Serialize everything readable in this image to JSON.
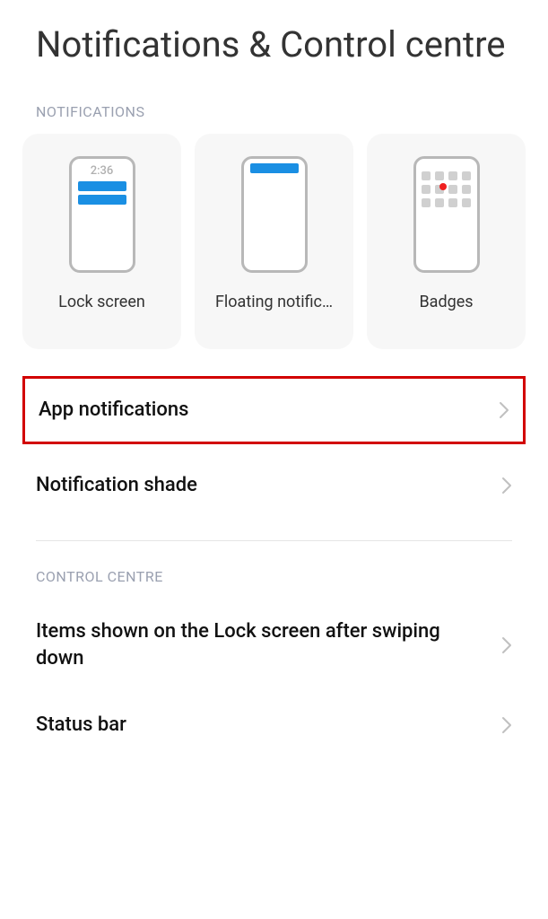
{
  "page": {
    "title": "Notifications & Control centre"
  },
  "section_notifications": {
    "header": "NOTIFICATIONS",
    "cards": {
      "lock_screen": {
        "label": "Lock screen",
        "time": "2:36"
      },
      "floating": {
        "label": "Floating notific…"
      },
      "badges": {
        "label": "Badges"
      }
    }
  },
  "rows": {
    "app_notifications": "App notifications",
    "notification_shade": "Notification shade"
  },
  "section_control": {
    "header": "CONTROL CENTRE",
    "rows": {
      "items_lock_screen": "Items shown on the Lock screen after swiping down",
      "status_bar": "Status bar"
    }
  }
}
